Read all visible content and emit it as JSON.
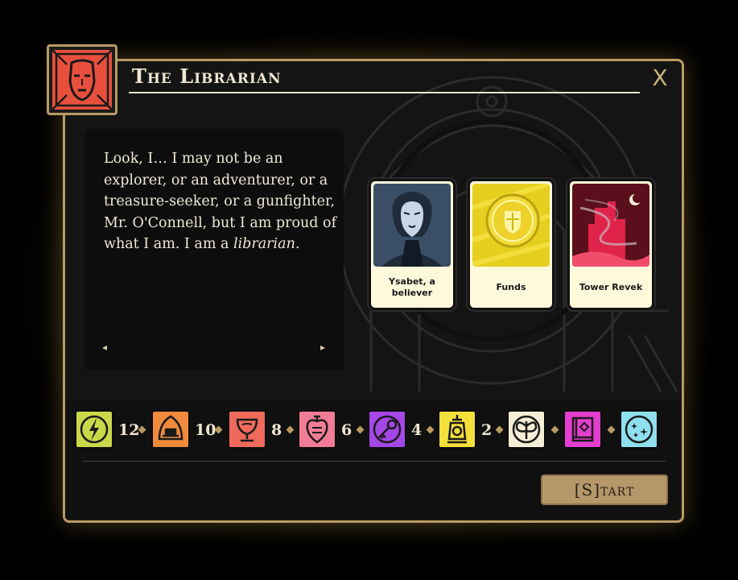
{
  "dialog": {
    "title": "The Librarian",
    "close_label": "X",
    "quote_before": "Look, I… I may not be an explorer, or an adventurer, or a treasure-seeker, or a gunfighter, Mr. O'Connell, but I am proud of what I am. I am a ",
    "quote_emphasis": "librarian",
    "quote_after": ".",
    "prev_arrow": "◂",
    "next_arrow": "▸"
  },
  "cards": [
    {
      "label": "Ysabet, a believer",
      "icon": "portrait-woman"
    },
    {
      "label": "Funds",
      "icon": "gold-coin"
    },
    {
      "label": "Tower Revek",
      "icon": "red-tower"
    }
  ],
  "aspects": [
    {
      "name": "lightning-aspect-icon",
      "color": "#c9d94a",
      "count": "12"
    },
    {
      "name": "forge-aspect-icon",
      "color": "#f08a3c",
      "count": "10"
    },
    {
      "name": "grail-aspect-icon",
      "color": "#f06a5c",
      "count": "8"
    },
    {
      "name": "heart-aspect-icon",
      "color": "#f07c96",
      "count": "6"
    },
    {
      "name": "key-aspect-icon",
      "color": "#a447e6",
      "count": "4"
    },
    {
      "name": "lantern-aspect-icon",
      "color": "#f4e03a",
      "count": "2"
    },
    {
      "name": "moth-aspect-icon",
      "color": "#f5edd5",
      "count": ""
    },
    {
      "name": "book-aspect-icon",
      "color": "#e43ed0",
      "count": ""
    },
    {
      "name": "stars-aspect-icon",
      "color": "#8fe0ee",
      "count": ""
    }
  ],
  "start_button": "[S]tart"
}
